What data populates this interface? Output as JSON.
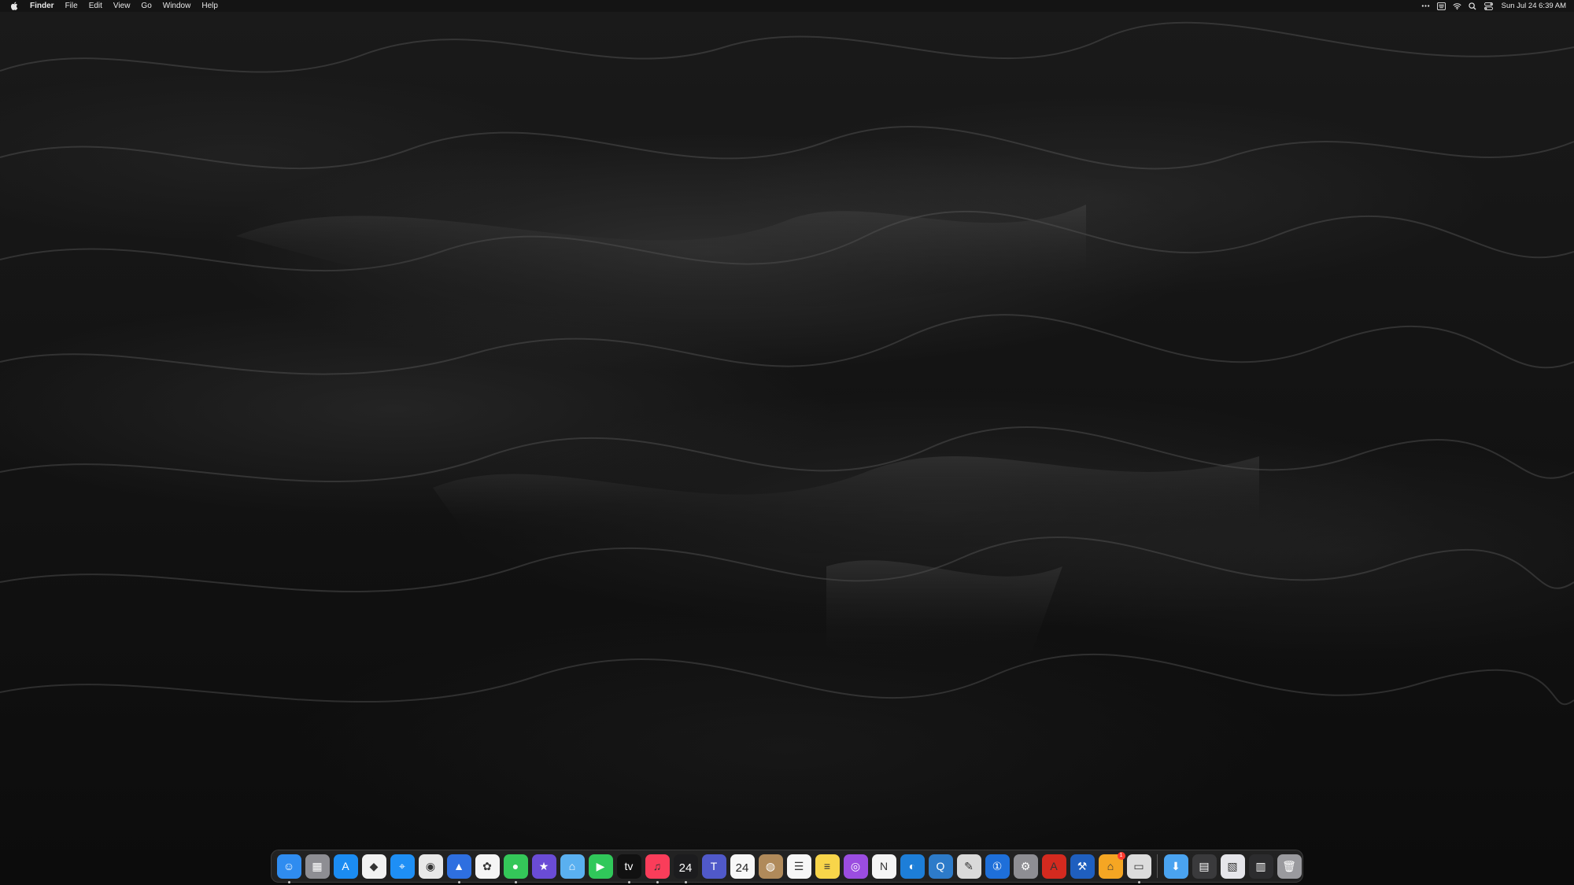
{
  "menubar": {
    "app_name": "Finder",
    "menus": [
      "File",
      "Edit",
      "View",
      "Go",
      "Window",
      "Help"
    ],
    "status_icons": [
      "more-icon",
      "keyboard-input-icon",
      "wifi-icon",
      "spotlight-search-icon",
      "control-center-icon"
    ],
    "clock": "Sun Jul 24  6:39 AM"
  },
  "dock": {
    "items": [
      {
        "name": "finder",
        "icon": "finder-icon",
        "color": "#2f8cf0",
        "glyph": "☺",
        "running": true
      },
      {
        "name": "launchpad",
        "icon": "launchpad-icon",
        "color": "#8e8e93",
        "glyph": "▦",
        "running": false
      },
      {
        "name": "app-store",
        "icon": "app-store-icon",
        "color": "#1b8cf2",
        "glyph": "A",
        "running": false
      },
      {
        "name": "dropbox",
        "icon": "dropbox-icon",
        "color": "#f2f2f2",
        "glyph": "◆",
        "running": false
      },
      {
        "name": "safari",
        "icon": "safari-icon",
        "color": "#1e8ff5",
        "glyph": "⌖",
        "running": false
      },
      {
        "name": "chrome",
        "icon": "chrome-icon",
        "color": "#e8e8e8",
        "glyph": "◉",
        "running": false
      },
      {
        "name": "xcode-instruments",
        "icon": "maps-arrow-icon",
        "color": "#2e6fe0",
        "glyph": "▲",
        "running": true
      },
      {
        "name": "photos",
        "icon": "photos-icon",
        "color": "#f4f4f4",
        "glyph": "✿",
        "running": false
      },
      {
        "name": "messages",
        "icon": "messages-icon",
        "color": "#34c759",
        "glyph": "●",
        "running": true
      },
      {
        "name": "imovie",
        "icon": "star-icon",
        "color": "#6a4cd6",
        "glyph": "★",
        "running": false
      },
      {
        "name": "maps",
        "icon": "maps-icon",
        "color": "#5ab0f0",
        "glyph": "⌂",
        "running": false
      },
      {
        "name": "facetime",
        "icon": "facetime-icon",
        "color": "#30c85a",
        "glyph": "▶",
        "running": false
      },
      {
        "name": "apple-tv",
        "icon": "apple-tv-icon",
        "color": "#111111",
        "glyph": "tv",
        "running": true
      },
      {
        "name": "music",
        "icon": "music-icon",
        "color": "#fa3d5a",
        "glyph": "♫",
        "running": true
      },
      {
        "name": "calendar-1",
        "icon": "calendar-icon",
        "color": "#1c1c1e",
        "glyph": "24",
        "running": true,
        "calendar": true,
        "dark": true
      },
      {
        "name": "teams",
        "icon": "teams-icon",
        "color": "#5059c9",
        "glyph": "T",
        "running": false
      },
      {
        "name": "calendar-2",
        "icon": "calendar-icon",
        "color": "#f7f7f7",
        "glyph": "24",
        "running": false,
        "calendar": true
      },
      {
        "name": "contacts",
        "icon": "contacts-icon",
        "color": "#b08a5a",
        "glyph": "◍",
        "running": false
      },
      {
        "name": "reminders",
        "icon": "reminders-icon",
        "color": "#f7f7f7",
        "glyph": "☰",
        "running": false
      },
      {
        "name": "notes",
        "icon": "notes-icon",
        "color": "#f8d54a",
        "glyph": "≡",
        "running": false
      },
      {
        "name": "podcasts",
        "icon": "podcasts-icon",
        "color": "#9b4de0",
        "glyph": "◎",
        "running": false
      },
      {
        "name": "news",
        "icon": "news-icon",
        "color": "#f5f5f5",
        "glyph": "N",
        "running": false
      },
      {
        "name": "blue-app",
        "icon": "globe-icon",
        "color": "#1d7ed8",
        "glyph": "◐",
        "running": false
      },
      {
        "name": "quicktime",
        "icon": "quicktime-icon",
        "color": "#2d7bc9",
        "glyph": "Q",
        "running": false
      },
      {
        "name": "script-editor",
        "icon": "script-editor-icon",
        "color": "#d9d9d9",
        "glyph": "✎",
        "running": false
      },
      {
        "name": "1password",
        "icon": "1password-icon",
        "color": "#1e6fd9",
        "glyph": "①",
        "running": false
      },
      {
        "name": "system-preferences",
        "icon": "gear-icon",
        "color": "#8e8e93",
        "glyph": "⚙",
        "running": false
      },
      {
        "name": "acrobat",
        "icon": "acrobat-icon",
        "color": "#d42a1f",
        "glyph": "A",
        "running": false
      },
      {
        "name": "xcode",
        "icon": "xcode-icon",
        "color": "#1f5fbf",
        "glyph": "⚒",
        "running": false
      },
      {
        "name": "home",
        "icon": "home-icon",
        "color": "#f5a623",
        "glyph": "⌂",
        "running": false,
        "badge": "1"
      },
      {
        "name": "screen-sharing",
        "icon": "screen-sharing-icon",
        "color": "#dcdcdc",
        "glyph": "▭",
        "running": true
      }
    ],
    "right_items": [
      {
        "name": "downloads-folder",
        "icon": "folder-icon",
        "color": "#4aa3f0",
        "glyph": "⬇"
      },
      {
        "name": "stack-1",
        "icon": "stack-icon",
        "color": "#3a3a3c",
        "glyph": "▤"
      },
      {
        "name": "stack-2",
        "icon": "document-stack-icon",
        "color": "#e5e5ea",
        "glyph": "▧"
      },
      {
        "name": "stack-3",
        "icon": "screenshot-stack-icon",
        "color": "#2c2c2e",
        "glyph": "▥"
      },
      {
        "name": "trash",
        "icon": "trash-icon",
        "color": "#9a9a9e",
        "glyph": "🗑"
      }
    ]
  }
}
